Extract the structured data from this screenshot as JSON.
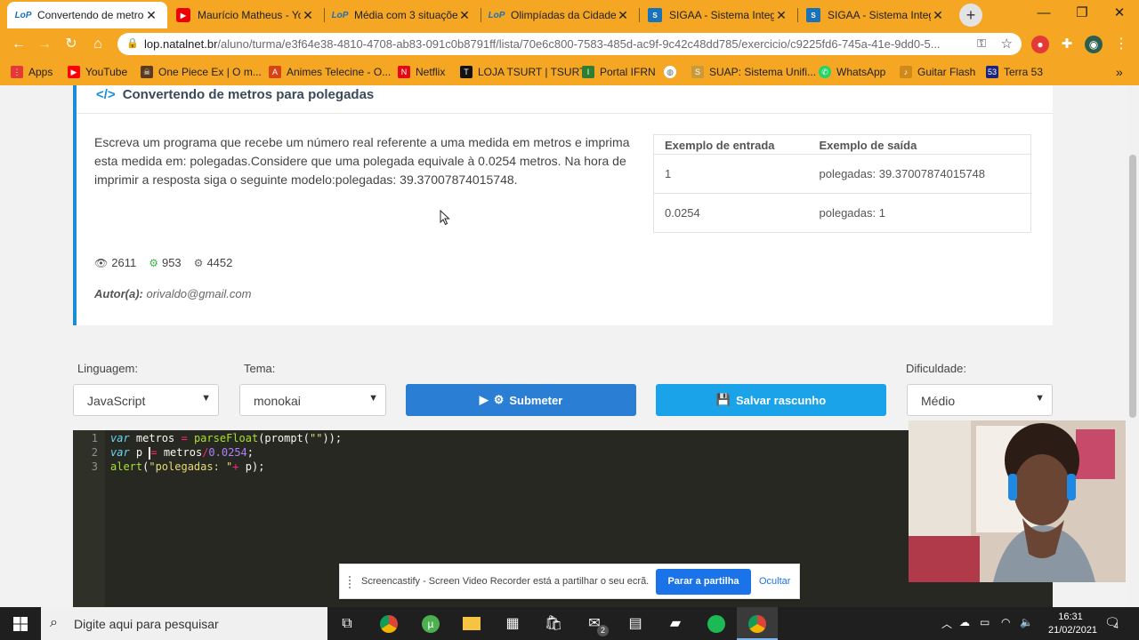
{
  "browser": {
    "tabs": [
      {
        "title": "Convertendo de metros p",
        "favicon": "lop-icon",
        "active": true
      },
      {
        "title": "Maurício Matheus - You",
        "favicon": "youtube-icon",
        "active": false
      },
      {
        "title": "Média com 3 situações",
        "favicon": "lop-icon",
        "active": false
      },
      {
        "title": "Olimpíadas da Cidade",
        "favicon": "lop-icon",
        "active": false
      },
      {
        "title": "SIGAA - Sistema Integr",
        "favicon": "sigaa-icon",
        "active": false
      },
      {
        "title": "SIGAA - Sistema Integr",
        "favicon": "sigaa-icon",
        "active": false
      }
    ],
    "url_host": "lop.natalnet.br",
    "url_path": "/aluno/turma/e3f64e38-4810-4708-ab83-091c0b8791ff/lista/70e6c800-7583-485d-ac9f-9c42c48dd785/exercicio/c9225fd6-745a-41e-9dd0-5...",
    "bookmarks": [
      {
        "label": "Apps",
        "icon": "apps-grid-icon",
        "color": "#e53935"
      },
      {
        "label": "YouTube",
        "icon": "youtube-icon",
        "color": "#ff0000"
      },
      {
        "label": "One Piece Ex | O m...",
        "icon": "one-piece-icon",
        "color": "#5b3a1e"
      },
      {
        "label": "Animes Telecine - O...",
        "icon": "animes-icon",
        "color": "#d84315"
      },
      {
        "label": "Netflix",
        "icon": "netflix-icon",
        "color": "#e50914"
      },
      {
        "label": "LOJA TSURT | TSURT",
        "icon": "tsurt-icon",
        "color": "#111111"
      },
      {
        "label": "Portal IFRN",
        "icon": "ifrn-icon",
        "color": "#2e7d32"
      },
      {
        "label": "",
        "icon": "globe-icon",
        "color": "#ffffff"
      },
      {
        "label": "SUAP: Sistema Unifi...",
        "icon": "suap-icon",
        "color": "#c99a3a"
      },
      {
        "label": "WhatsApp",
        "icon": "whatsapp-icon",
        "color": "#25d366"
      },
      {
        "label": "Guitar Flash",
        "icon": "guitar-icon",
        "color": "#d08a1a"
      },
      {
        "label": "Terra 53",
        "icon": "terra-icon",
        "color": "#1a237e"
      }
    ]
  },
  "problem": {
    "title": "Convertendo de metros para polegadas",
    "description": "Escreva um programa que recebe um número real referente a uma medida em metros e imprima esta medida em: polegadas.Considere que uma polegada equivale à 0.0254 metros. Na hora de imprimir a resposta siga o seguinte modelo:polegadas: 39.37007874015748.",
    "examples_header": {
      "input": "Exemplo de entrada",
      "output": "Exemplo de saída"
    },
    "examples": [
      {
        "input": "1",
        "output": "polegadas: 39.37007874015748"
      },
      {
        "input": "0.0254",
        "output": "polegadas: 1"
      }
    ],
    "stats": {
      "views": "2611",
      "correct": "953",
      "submissions": "4452"
    },
    "author_label": "Autor(a):",
    "author": "orivaldo@gmail.com"
  },
  "controls": {
    "language_label": "Linguagem:",
    "language_value": "JavaScript",
    "theme_label": "Tema:",
    "theme_value": "monokai",
    "submit_label": "Submeter",
    "save_label": "Salvar rascunho",
    "difficulty_label": "Dificuldade:",
    "difficulty_value": "Médio"
  },
  "editor": {
    "line_numbers": [
      "1",
      "2",
      "3"
    ],
    "lines": [
      "var metros = parseFloat(prompt(\"\"));",
      "var p = metros/0.0254;",
      "alert(\"polegadas: \"+ p);"
    ]
  },
  "share_bar": {
    "message": "Screencastify - Screen Video Recorder está a partilhar o seu ecrã.",
    "stop_label": "Parar a partilha",
    "hide_label": "Ocultar"
  },
  "taskbar": {
    "search_placeholder": "Digite aqui para pesquisar",
    "time": "16:31",
    "date": "21/02/2021",
    "notification_count": "4",
    "mail_badge": "2"
  },
  "colors": {
    "chrome_accent": "#f5a623",
    "card_accent": "#1a8cd8",
    "submit_button": "#2a7fd4",
    "save_button": "#1aa3e8",
    "editor_bg": "#272822"
  }
}
